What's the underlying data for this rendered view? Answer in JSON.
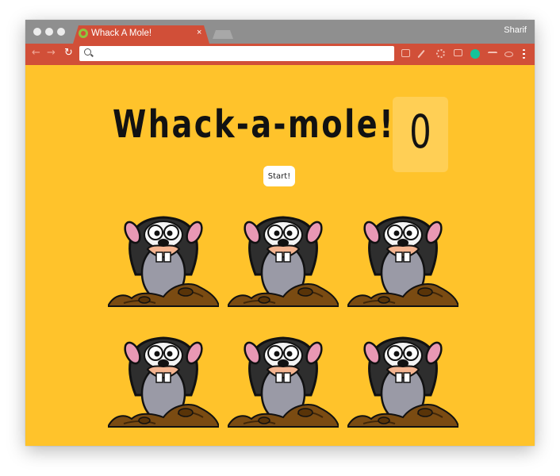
{
  "browser": {
    "tab_title": "Whack A Mole!",
    "tab_close": "×",
    "user_name": "Sharif",
    "back_glyph": "←",
    "forward_glyph": "→",
    "reload_glyph": "↻",
    "address_value": "",
    "address_icon": "search-icon",
    "extension_icons": [
      "cast-icon",
      "eyedropper-icon",
      "gear-icon",
      "window-icon",
      "grammarly-icon",
      "m-icon",
      "react-icon",
      "menu-icon"
    ]
  },
  "game": {
    "title": "Whack-a-mole!",
    "score": "0",
    "start_label": "Start!",
    "holes": [
      {
        "label": "mole"
      },
      {
        "label": "mole"
      },
      {
        "label": "mole"
      },
      {
        "label": "mole"
      },
      {
        "label": "mole"
      },
      {
        "label": "mole"
      }
    ]
  },
  "colors": {
    "page_background": "#ffc32b",
    "browser_chrome": "#d14f38",
    "titlebar": "#8f8f8f"
  }
}
